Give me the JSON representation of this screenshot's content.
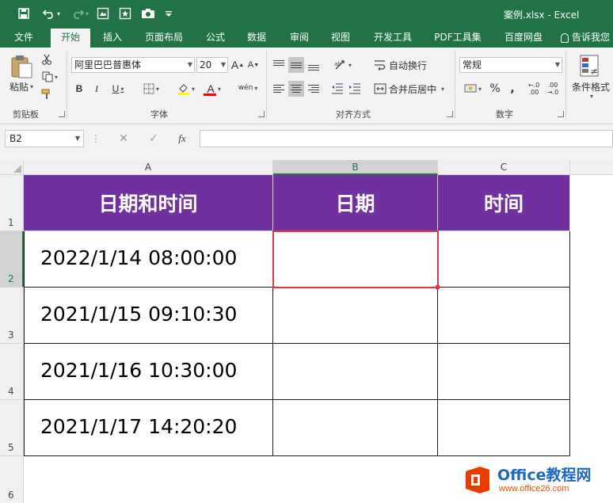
{
  "window": {
    "title": "案例.xlsx - Excel"
  },
  "tabs": [
    {
      "label": "文件"
    },
    {
      "label": "开始"
    },
    {
      "label": "插入"
    },
    {
      "label": "页面布局"
    },
    {
      "label": "公式"
    },
    {
      "label": "数据"
    },
    {
      "label": "审阅"
    },
    {
      "label": "视图"
    },
    {
      "label": "开发工具"
    },
    {
      "label": "PDF工具集"
    },
    {
      "label": "百度网盘"
    },
    {
      "label": "告诉我您"
    }
  ],
  "ribbon": {
    "clipboard": {
      "paste_label": "粘贴",
      "group_label": "剪贴板"
    },
    "font": {
      "font_name": "阿里巴巴普惠体",
      "font_size": "20",
      "group_label": "字体",
      "grow_label": "A",
      "shrink_label": "A",
      "bold": "B",
      "italic": "I",
      "underline": "U",
      "color_label": "A",
      "phonetic_label": "wén"
    },
    "alignment": {
      "wrap_label": "自动换行",
      "merge_label": "合并后居中",
      "group_label": "对齐方式"
    },
    "number": {
      "format": "常规",
      "percent": "%",
      "comma": ",",
      "group_label": "数字"
    },
    "styles": {
      "cond_format_label": "条件格式"
    }
  },
  "formula_bar": {
    "name_box": "B2",
    "fx": "fx",
    "value": ""
  },
  "sheet": {
    "columns": [
      "A",
      "B",
      "C"
    ],
    "rows": [
      "1",
      "2",
      "3",
      "4",
      "5",
      "6"
    ],
    "header": [
      "日期和时间",
      "日期",
      "时间"
    ],
    "data": [
      [
        "2022/1/14  08:00:00",
        "",
        ""
      ],
      [
        "2021/1/15  09:10:30",
        "",
        ""
      ],
      [
        "2021/1/16  10:30:00",
        "",
        ""
      ],
      [
        "2021/1/17  14:20:20",
        "",
        ""
      ]
    ],
    "selected_cell": "B2",
    "header_fill": "#7030a0",
    "selection_color": "#e0393e"
  },
  "watermark": {
    "brand": "Office教程网",
    "url": "www.office26.com"
  },
  "colors": {
    "excel_green": "#217346",
    "ribbon_bg": "#f3f3f3"
  }
}
